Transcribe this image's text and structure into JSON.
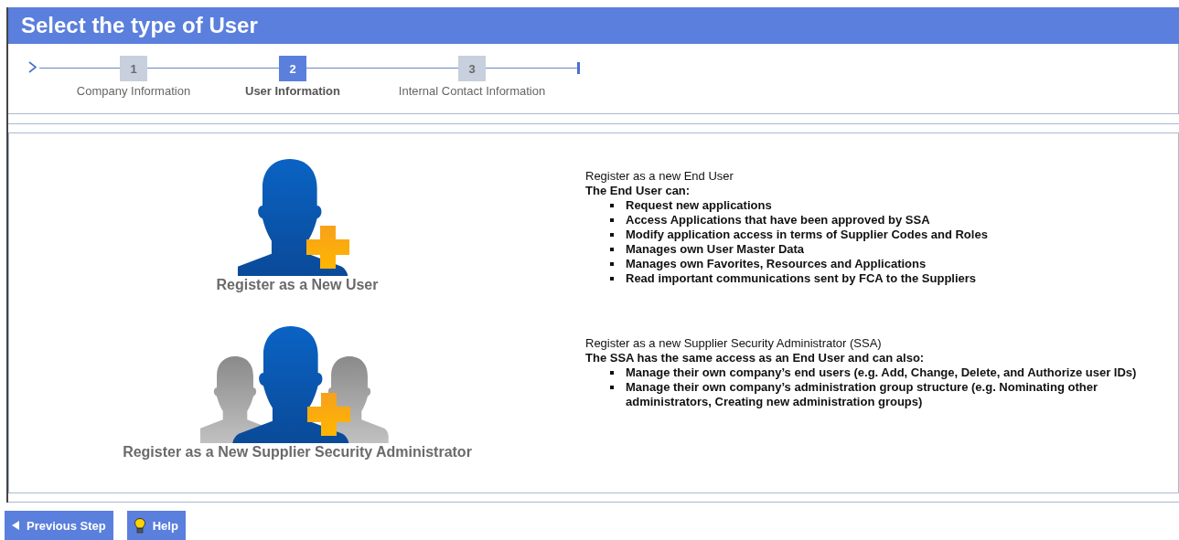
{
  "header": {
    "title": "Select the type of User"
  },
  "steps": [
    {
      "number": "1",
      "label": "Company Information",
      "selected": false
    },
    {
      "number": "2",
      "label": "User Information",
      "selected": true
    },
    {
      "number": "3",
      "label": "Internal Contact Information",
      "selected": false
    }
  ],
  "options": [
    {
      "kind": "single",
      "label": "Register as a New User",
      "heading": "Register as a new End User",
      "intro": "The End User can:",
      "bullets": [
        "Request new applications",
        "Access Applications that have been approved by SSA",
        "Modify application access in terms of Supplier Codes and Roles",
        "Manages own User Master Data",
        "Manages own Favorites, Resources and Applications",
        "Read important communications sent by FCA to the Suppliers"
      ]
    },
    {
      "kind": "group",
      "label": "Register as a New Supplier Security Administrator",
      "heading": "Register as a new Supplier Security Administrator (SSA)",
      "intro": "The SSA has the same access as an End User and can also:",
      "bullets": [
        "Manage their own company’s end users (e.g. Add, Change, Delete, and Authorize user IDs)",
        "Manage their own company’s administration group structure (e.g. Nominating other administrators, Creating new administration groups)"
      ]
    }
  ],
  "buttons": [
    {
      "kind": "back",
      "label": "Previous Step"
    },
    {
      "kind": "help",
      "label": "Help"
    }
  ]
}
